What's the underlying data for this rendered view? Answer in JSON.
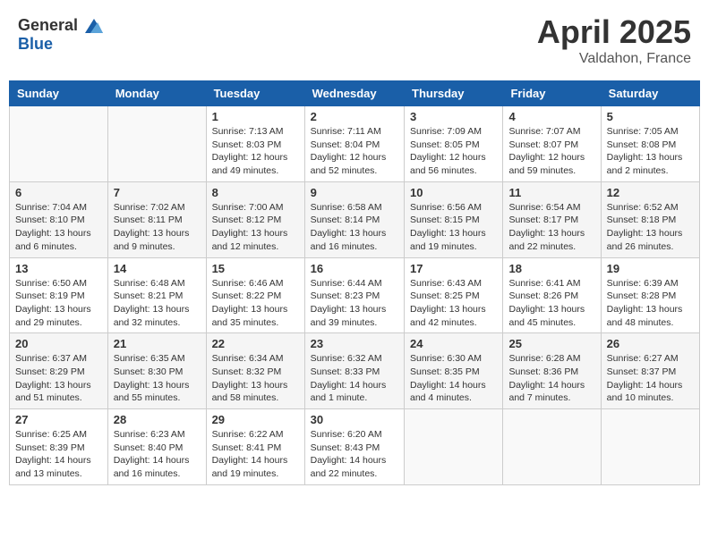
{
  "header": {
    "logo_general": "General",
    "logo_blue": "Blue",
    "title": "April 2025",
    "subtitle": "Valdahon, France"
  },
  "days_of_week": [
    "Sunday",
    "Monday",
    "Tuesday",
    "Wednesday",
    "Thursday",
    "Friday",
    "Saturday"
  ],
  "weeks": [
    [
      {
        "day": "",
        "info": ""
      },
      {
        "day": "",
        "info": ""
      },
      {
        "day": "1",
        "info": "Sunrise: 7:13 AM\nSunset: 8:03 PM\nDaylight: 12 hours and 49 minutes."
      },
      {
        "day": "2",
        "info": "Sunrise: 7:11 AM\nSunset: 8:04 PM\nDaylight: 12 hours and 52 minutes."
      },
      {
        "day": "3",
        "info": "Sunrise: 7:09 AM\nSunset: 8:05 PM\nDaylight: 12 hours and 56 minutes."
      },
      {
        "day": "4",
        "info": "Sunrise: 7:07 AM\nSunset: 8:07 PM\nDaylight: 12 hours and 59 minutes."
      },
      {
        "day": "5",
        "info": "Sunrise: 7:05 AM\nSunset: 8:08 PM\nDaylight: 13 hours and 2 minutes."
      }
    ],
    [
      {
        "day": "6",
        "info": "Sunrise: 7:04 AM\nSunset: 8:10 PM\nDaylight: 13 hours and 6 minutes."
      },
      {
        "day": "7",
        "info": "Sunrise: 7:02 AM\nSunset: 8:11 PM\nDaylight: 13 hours and 9 minutes."
      },
      {
        "day": "8",
        "info": "Sunrise: 7:00 AM\nSunset: 8:12 PM\nDaylight: 13 hours and 12 minutes."
      },
      {
        "day": "9",
        "info": "Sunrise: 6:58 AM\nSunset: 8:14 PM\nDaylight: 13 hours and 16 minutes."
      },
      {
        "day": "10",
        "info": "Sunrise: 6:56 AM\nSunset: 8:15 PM\nDaylight: 13 hours and 19 minutes."
      },
      {
        "day": "11",
        "info": "Sunrise: 6:54 AM\nSunset: 8:17 PM\nDaylight: 13 hours and 22 minutes."
      },
      {
        "day": "12",
        "info": "Sunrise: 6:52 AM\nSunset: 8:18 PM\nDaylight: 13 hours and 26 minutes."
      }
    ],
    [
      {
        "day": "13",
        "info": "Sunrise: 6:50 AM\nSunset: 8:19 PM\nDaylight: 13 hours and 29 minutes."
      },
      {
        "day": "14",
        "info": "Sunrise: 6:48 AM\nSunset: 8:21 PM\nDaylight: 13 hours and 32 minutes."
      },
      {
        "day": "15",
        "info": "Sunrise: 6:46 AM\nSunset: 8:22 PM\nDaylight: 13 hours and 35 minutes."
      },
      {
        "day": "16",
        "info": "Sunrise: 6:44 AM\nSunset: 8:23 PM\nDaylight: 13 hours and 39 minutes."
      },
      {
        "day": "17",
        "info": "Sunrise: 6:43 AM\nSunset: 8:25 PM\nDaylight: 13 hours and 42 minutes."
      },
      {
        "day": "18",
        "info": "Sunrise: 6:41 AM\nSunset: 8:26 PM\nDaylight: 13 hours and 45 minutes."
      },
      {
        "day": "19",
        "info": "Sunrise: 6:39 AM\nSunset: 8:28 PM\nDaylight: 13 hours and 48 minutes."
      }
    ],
    [
      {
        "day": "20",
        "info": "Sunrise: 6:37 AM\nSunset: 8:29 PM\nDaylight: 13 hours and 51 minutes."
      },
      {
        "day": "21",
        "info": "Sunrise: 6:35 AM\nSunset: 8:30 PM\nDaylight: 13 hours and 55 minutes."
      },
      {
        "day": "22",
        "info": "Sunrise: 6:34 AM\nSunset: 8:32 PM\nDaylight: 13 hours and 58 minutes."
      },
      {
        "day": "23",
        "info": "Sunrise: 6:32 AM\nSunset: 8:33 PM\nDaylight: 14 hours and 1 minute."
      },
      {
        "day": "24",
        "info": "Sunrise: 6:30 AM\nSunset: 8:35 PM\nDaylight: 14 hours and 4 minutes."
      },
      {
        "day": "25",
        "info": "Sunrise: 6:28 AM\nSunset: 8:36 PM\nDaylight: 14 hours and 7 minutes."
      },
      {
        "day": "26",
        "info": "Sunrise: 6:27 AM\nSunset: 8:37 PM\nDaylight: 14 hours and 10 minutes."
      }
    ],
    [
      {
        "day": "27",
        "info": "Sunrise: 6:25 AM\nSunset: 8:39 PM\nDaylight: 14 hours and 13 minutes."
      },
      {
        "day": "28",
        "info": "Sunrise: 6:23 AM\nSunset: 8:40 PM\nDaylight: 14 hours and 16 minutes."
      },
      {
        "day": "29",
        "info": "Sunrise: 6:22 AM\nSunset: 8:41 PM\nDaylight: 14 hours and 19 minutes."
      },
      {
        "day": "30",
        "info": "Sunrise: 6:20 AM\nSunset: 8:43 PM\nDaylight: 14 hours and 22 minutes."
      },
      {
        "day": "",
        "info": ""
      },
      {
        "day": "",
        "info": ""
      },
      {
        "day": "",
        "info": ""
      }
    ]
  ]
}
